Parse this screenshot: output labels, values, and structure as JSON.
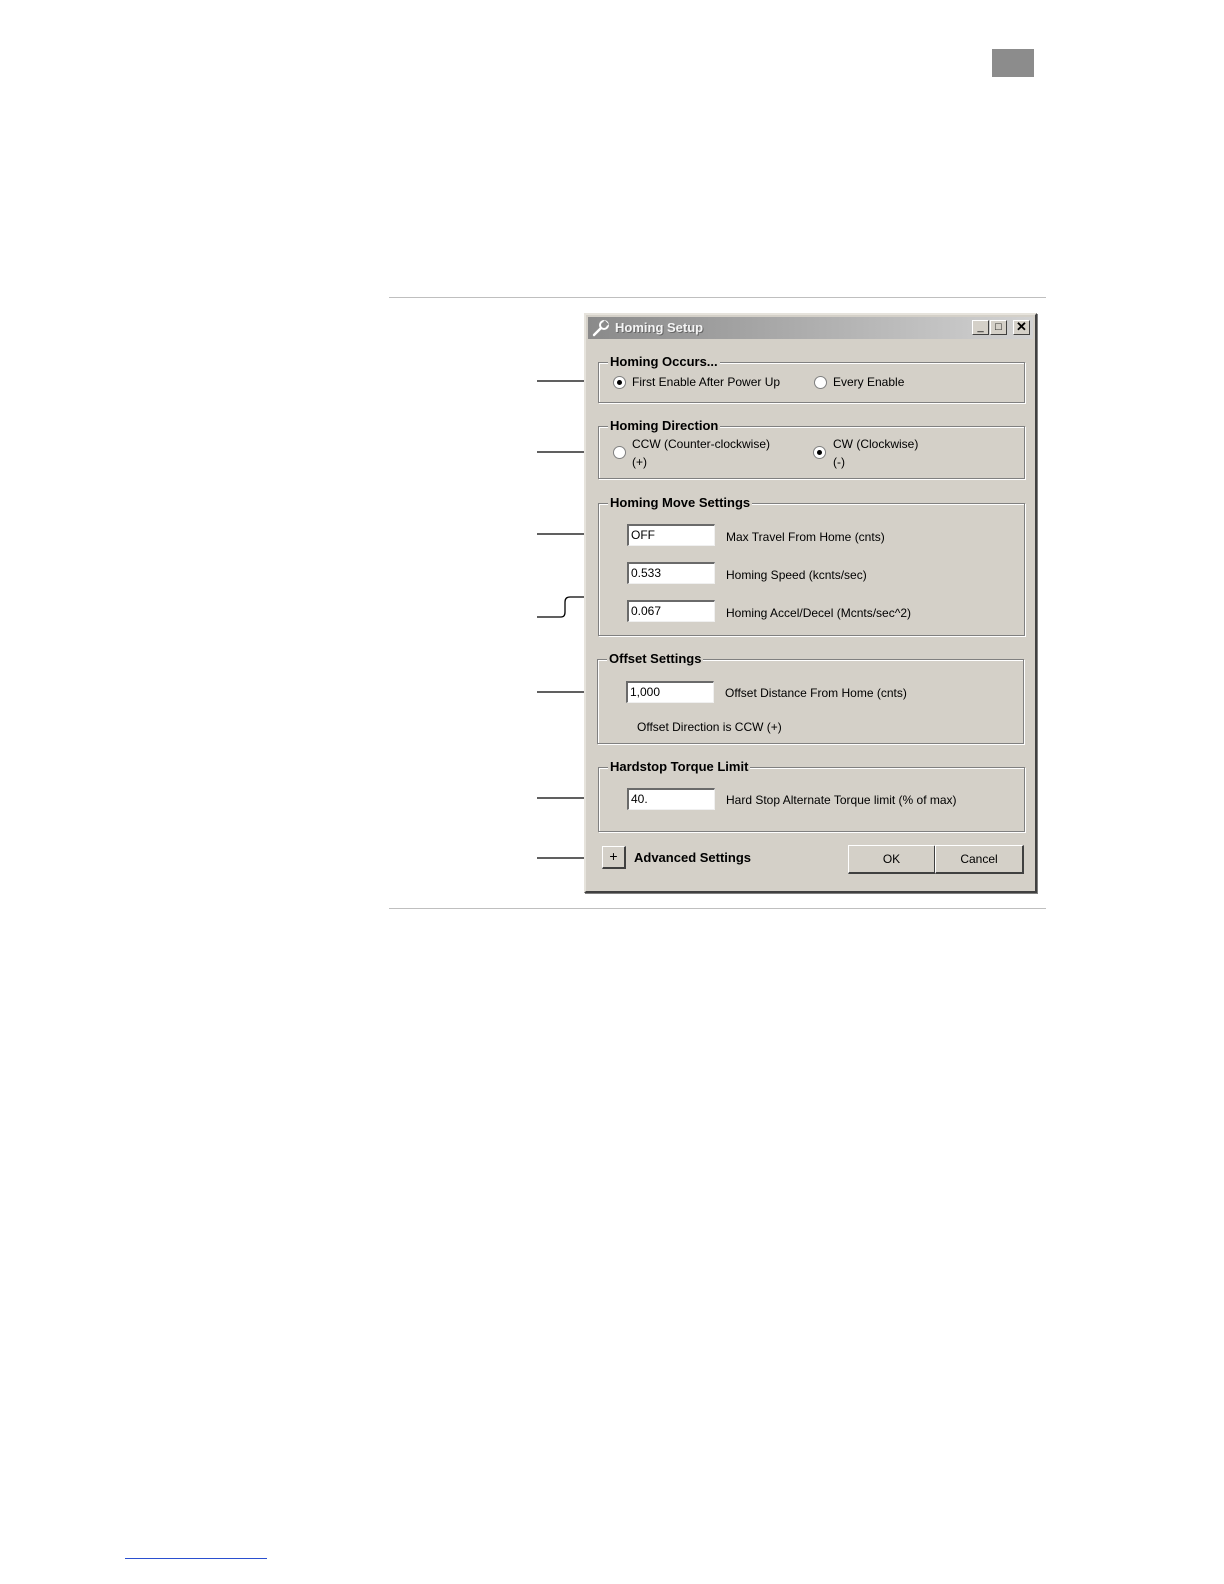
{
  "dialog": {
    "title": "Homing Setup",
    "window_buttons": {
      "minimize": "_",
      "maximize": "□",
      "close": "✕"
    }
  },
  "homing_occurs": {
    "title": "Homing Occurs...",
    "options": [
      {
        "label": "First Enable After Power Up",
        "selected": true
      },
      {
        "label": "Every Enable",
        "selected": false
      }
    ]
  },
  "homing_direction": {
    "title": "Homing Direction",
    "options": [
      {
        "label": "CCW (Counter-clockwise)",
        "sub": "(+)",
        "selected": false
      },
      {
        "label": "CW (Clockwise)",
        "sub": "(-)",
        "selected": true
      }
    ]
  },
  "homing_move": {
    "title": "Homing Move Settings",
    "fields": [
      {
        "value": "OFF",
        "label": "Max Travel From Home (cnts)"
      },
      {
        "value": "0.533",
        "label": "Homing Speed (kcnts/sec)"
      },
      {
        "value": "0.067",
        "label": "Homing Accel/Decel (Mcnts/sec^2)"
      }
    ]
  },
  "offset": {
    "title": "Offset Settings",
    "value": "1,000",
    "label": "Offset Distance From Home (cnts)",
    "direction_text": "Offset Direction is CCW (+)"
  },
  "hardstop": {
    "title": "Hardstop Torque Limit",
    "value": "40.",
    "label": "Hard Stop Alternate Torque limit (% of max)"
  },
  "footer": {
    "expand_symbol": "+",
    "advanced_label": "Advanced Settings",
    "ok_label": "OK",
    "cancel_label": "Cancel"
  },
  "colors": {
    "dialog_face": "#d4d0c8",
    "titlebar_start": "#8a8a8a",
    "titlebar_end": "#d2d2d2",
    "page_tab": "#8c8c8c",
    "footer_link": "#2a4fd0"
  },
  "icons": {
    "title": "wrench-icon"
  }
}
